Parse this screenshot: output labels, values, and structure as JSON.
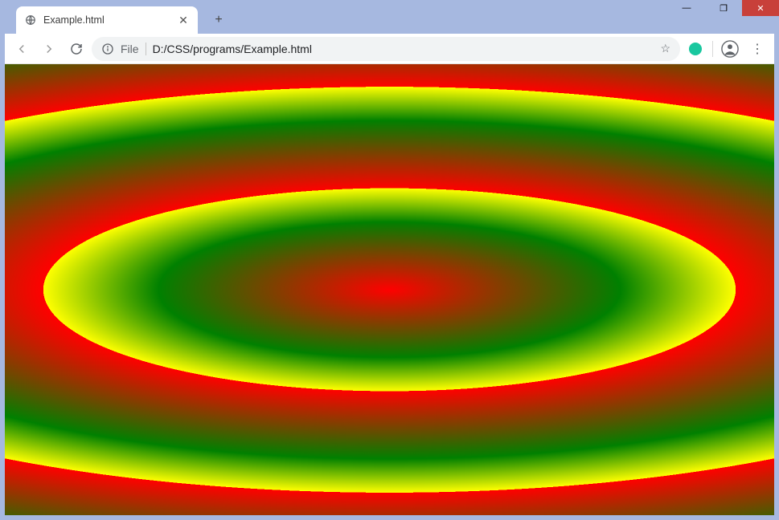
{
  "window": {
    "minimize_glyph": "—",
    "maximize_glyph": "❐",
    "close_glyph": "✕"
  },
  "tab": {
    "title": "Example.html",
    "close_glyph": "✕",
    "newtab_glyph": "+"
  },
  "toolbar": {
    "file_label": "File",
    "url": "D:/CSS/programs/Example.html",
    "star_glyph": "☆",
    "menu_glyph": "⋮"
  },
  "page": {
    "gradient": {
      "type": "repeating-radial-gradient",
      "shape": "ellipse",
      "stops": [
        "red",
        "green",
        "yellow"
      ]
    }
  }
}
